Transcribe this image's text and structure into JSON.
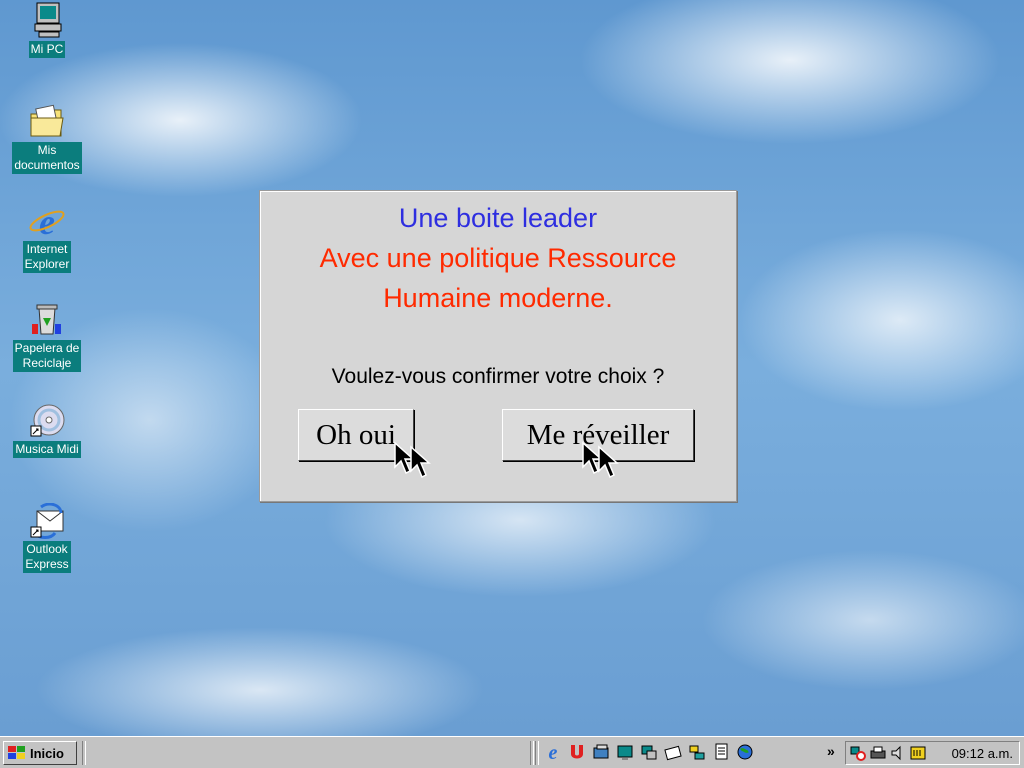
{
  "desktop": {
    "icons": [
      {
        "label": "Mi PC",
        "icon": "my-computer-icon"
      },
      {
        "label": "Mis\ndocumentos",
        "icon": "folder-icon"
      },
      {
        "label": "Internet\nExplorer",
        "icon": "internet-explorer-icon"
      },
      {
        "label": "Papelera de\nReciclaje",
        "icon": "recycle-bin-icon"
      },
      {
        "label": "Musica Midi",
        "icon": "cd-icon"
      },
      {
        "label": "Outlook\nExpress",
        "icon": "outlook-express-icon"
      }
    ]
  },
  "dialog": {
    "line1": "Une boite leader",
    "line2": "Avec une politique Ressource",
    "line3": "Humaine moderne.",
    "question": "Voulez-vous confirmer votre choix ?",
    "button_yes": "Oh oui",
    "button_wake": "Me réveiller",
    "colors": {
      "line1": "#2e2ee0",
      "line2": "#ff2a00"
    }
  },
  "taskbar": {
    "start_label": "Inicio",
    "clock": "09:12 a.m.",
    "quick_launch": [
      "internet-explorer-icon",
      "outlook-icon",
      "show-desktop-icon",
      "monitor-icon",
      "network-icon",
      "mail-icon",
      "explorer-icon",
      "document-icon",
      "globe-icon"
    ],
    "chevron": "»",
    "tray": [
      "network-tray-icon",
      "printer-tray-icon",
      "volume-icon",
      "scheduler-icon"
    ]
  }
}
